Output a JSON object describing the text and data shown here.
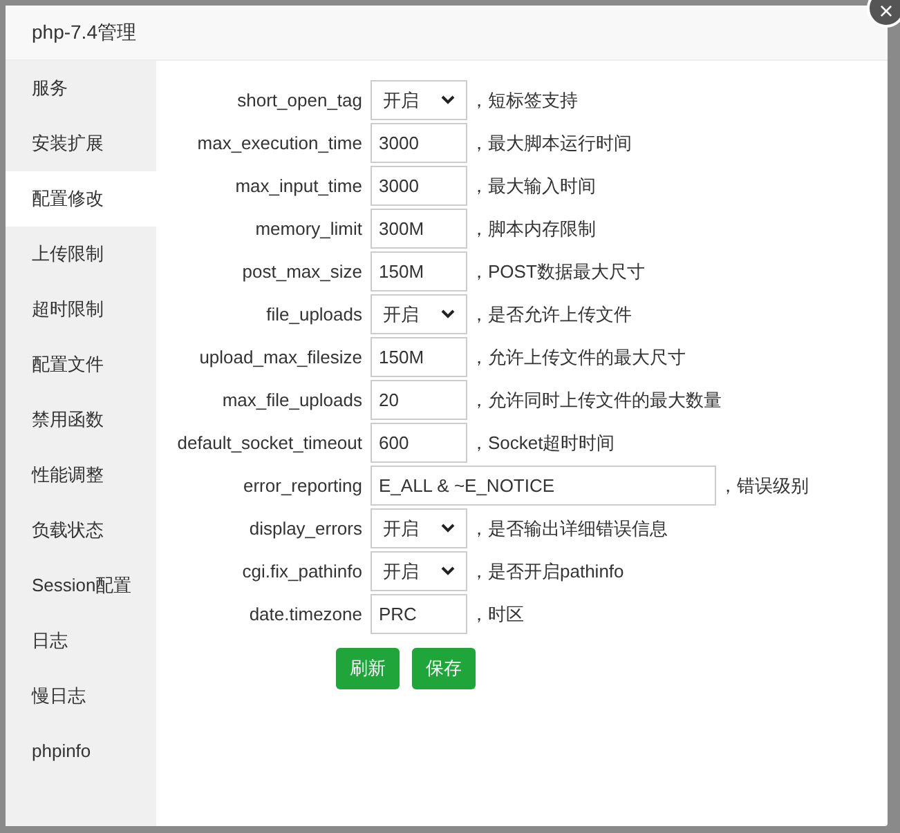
{
  "dialog": {
    "title": "php-7.4管理",
    "close_label": "×"
  },
  "sidebar": {
    "items": [
      {
        "label": "服务",
        "selected": false
      },
      {
        "label": "安装扩展",
        "selected": false
      },
      {
        "label": "配置修改",
        "selected": true
      },
      {
        "label": "上传限制",
        "selected": false
      },
      {
        "label": "超时限制",
        "selected": false
      },
      {
        "label": "配置文件",
        "selected": false
      },
      {
        "label": "禁用函数",
        "selected": false
      },
      {
        "label": "性能调整",
        "selected": false
      },
      {
        "label": "负载状态",
        "selected": false
      },
      {
        "label": "Session配置",
        "selected": false
      },
      {
        "label": "日志",
        "selected": false
      },
      {
        "label": "慢日志",
        "selected": false
      },
      {
        "label": "phpinfo",
        "selected": false
      }
    ]
  },
  "settings": [
    {
      "label": "short_open_tag",
      "kind": "select",
      "value": "开启",
      "hint": "，短标签支持"
    },
    {
      "label": "max_execution_time",
      "kind": "text",
      "value": "3000",
      "hint": "，最大脚本运行时间"
    },
    {
      "label": "max_input_time",
      "kind": "text",
      "value": "3000",
      "hint": "，最大输入时间"
    },
    {
      "label": "memory_limit",
      "kind": "text",
      "value": "300M",
      "hint": "，脚本内存限制"
    },
    {
      "label": "post_max_size",
      "kind": "text",
      "value": "150M",
      "hint": "，POST数据最大尺寸"
    },
    {
      "label": "file_uploads",
      "kind": "select",
      "value": "开启",
      "hint": "，是否允许上传文件"
    },
    {
      "label": "upload_max_filesize",
      "kind": "text",
      "value": "150M",
      "hint": "，允许上传文件的最大尺寸"
    },
    {
      "label": "max_file_uploads",
      "kind": "text",
      "value": "20",
      "hint": "，允许同时上传文件的最大数量"
    },
    {
      "label": "default_socket_timeout",
      "kind": "text",
      "value": "600",
      "hint": "，Socket超时时间"
    },
    {
      "label": "error_reporting",
      "kind": "longtext",
      "value": "E_ALL & ~E_NOTICE",
      "hint": "，错误级别"
    },
    {
      "label": "display_errors",
      "kind": "select",
      "value": "开启",
      "hint": "，是否输出详细错误信息"
    },
    {
      "label": "cgi.fix_pathinfo",
      "kind": "select",
      "value": "开启",
      "hint": "，是否开启pathinfo"
    },
    {
      "label": "date.timezone",
      "kind": "text",
      "value": "PRC",
      "hint": "，时区"
    }
  ],
  "buttons": [
    "刷新",
    "保存"
  ]
}
